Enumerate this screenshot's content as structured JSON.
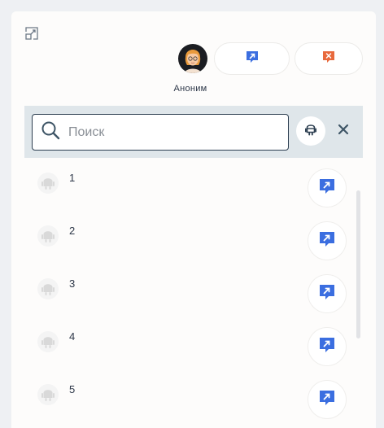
{
  "header": {
    "expand_icon": "expand-icon",
    "user_name": "Аноним",
    "chat_button_icon": "chat-arrow-icon",
    "close_button_icon": "chat-close-icon"
  },
  "search": {
    "placeholder": "Поиск",
    "value": "",
    "filter_icon": "android-icon",
    "clear_icon": "close-icon"
  },
  "colors": {
    "accent_blue": "#3b6ee0",
    "accent_orange": "#e8693c",
    "search_bar_bg": "#dfe6ea",
    "text_dark": "#2d3748"
  },
  "items": [
    {
      "label": "1"
    },
    {
      "label": "2"
    },
    {
      "label": "3"
    },
    {
      "label": "4"
    },
    {
      "label": "5"
    }
  ]
}
